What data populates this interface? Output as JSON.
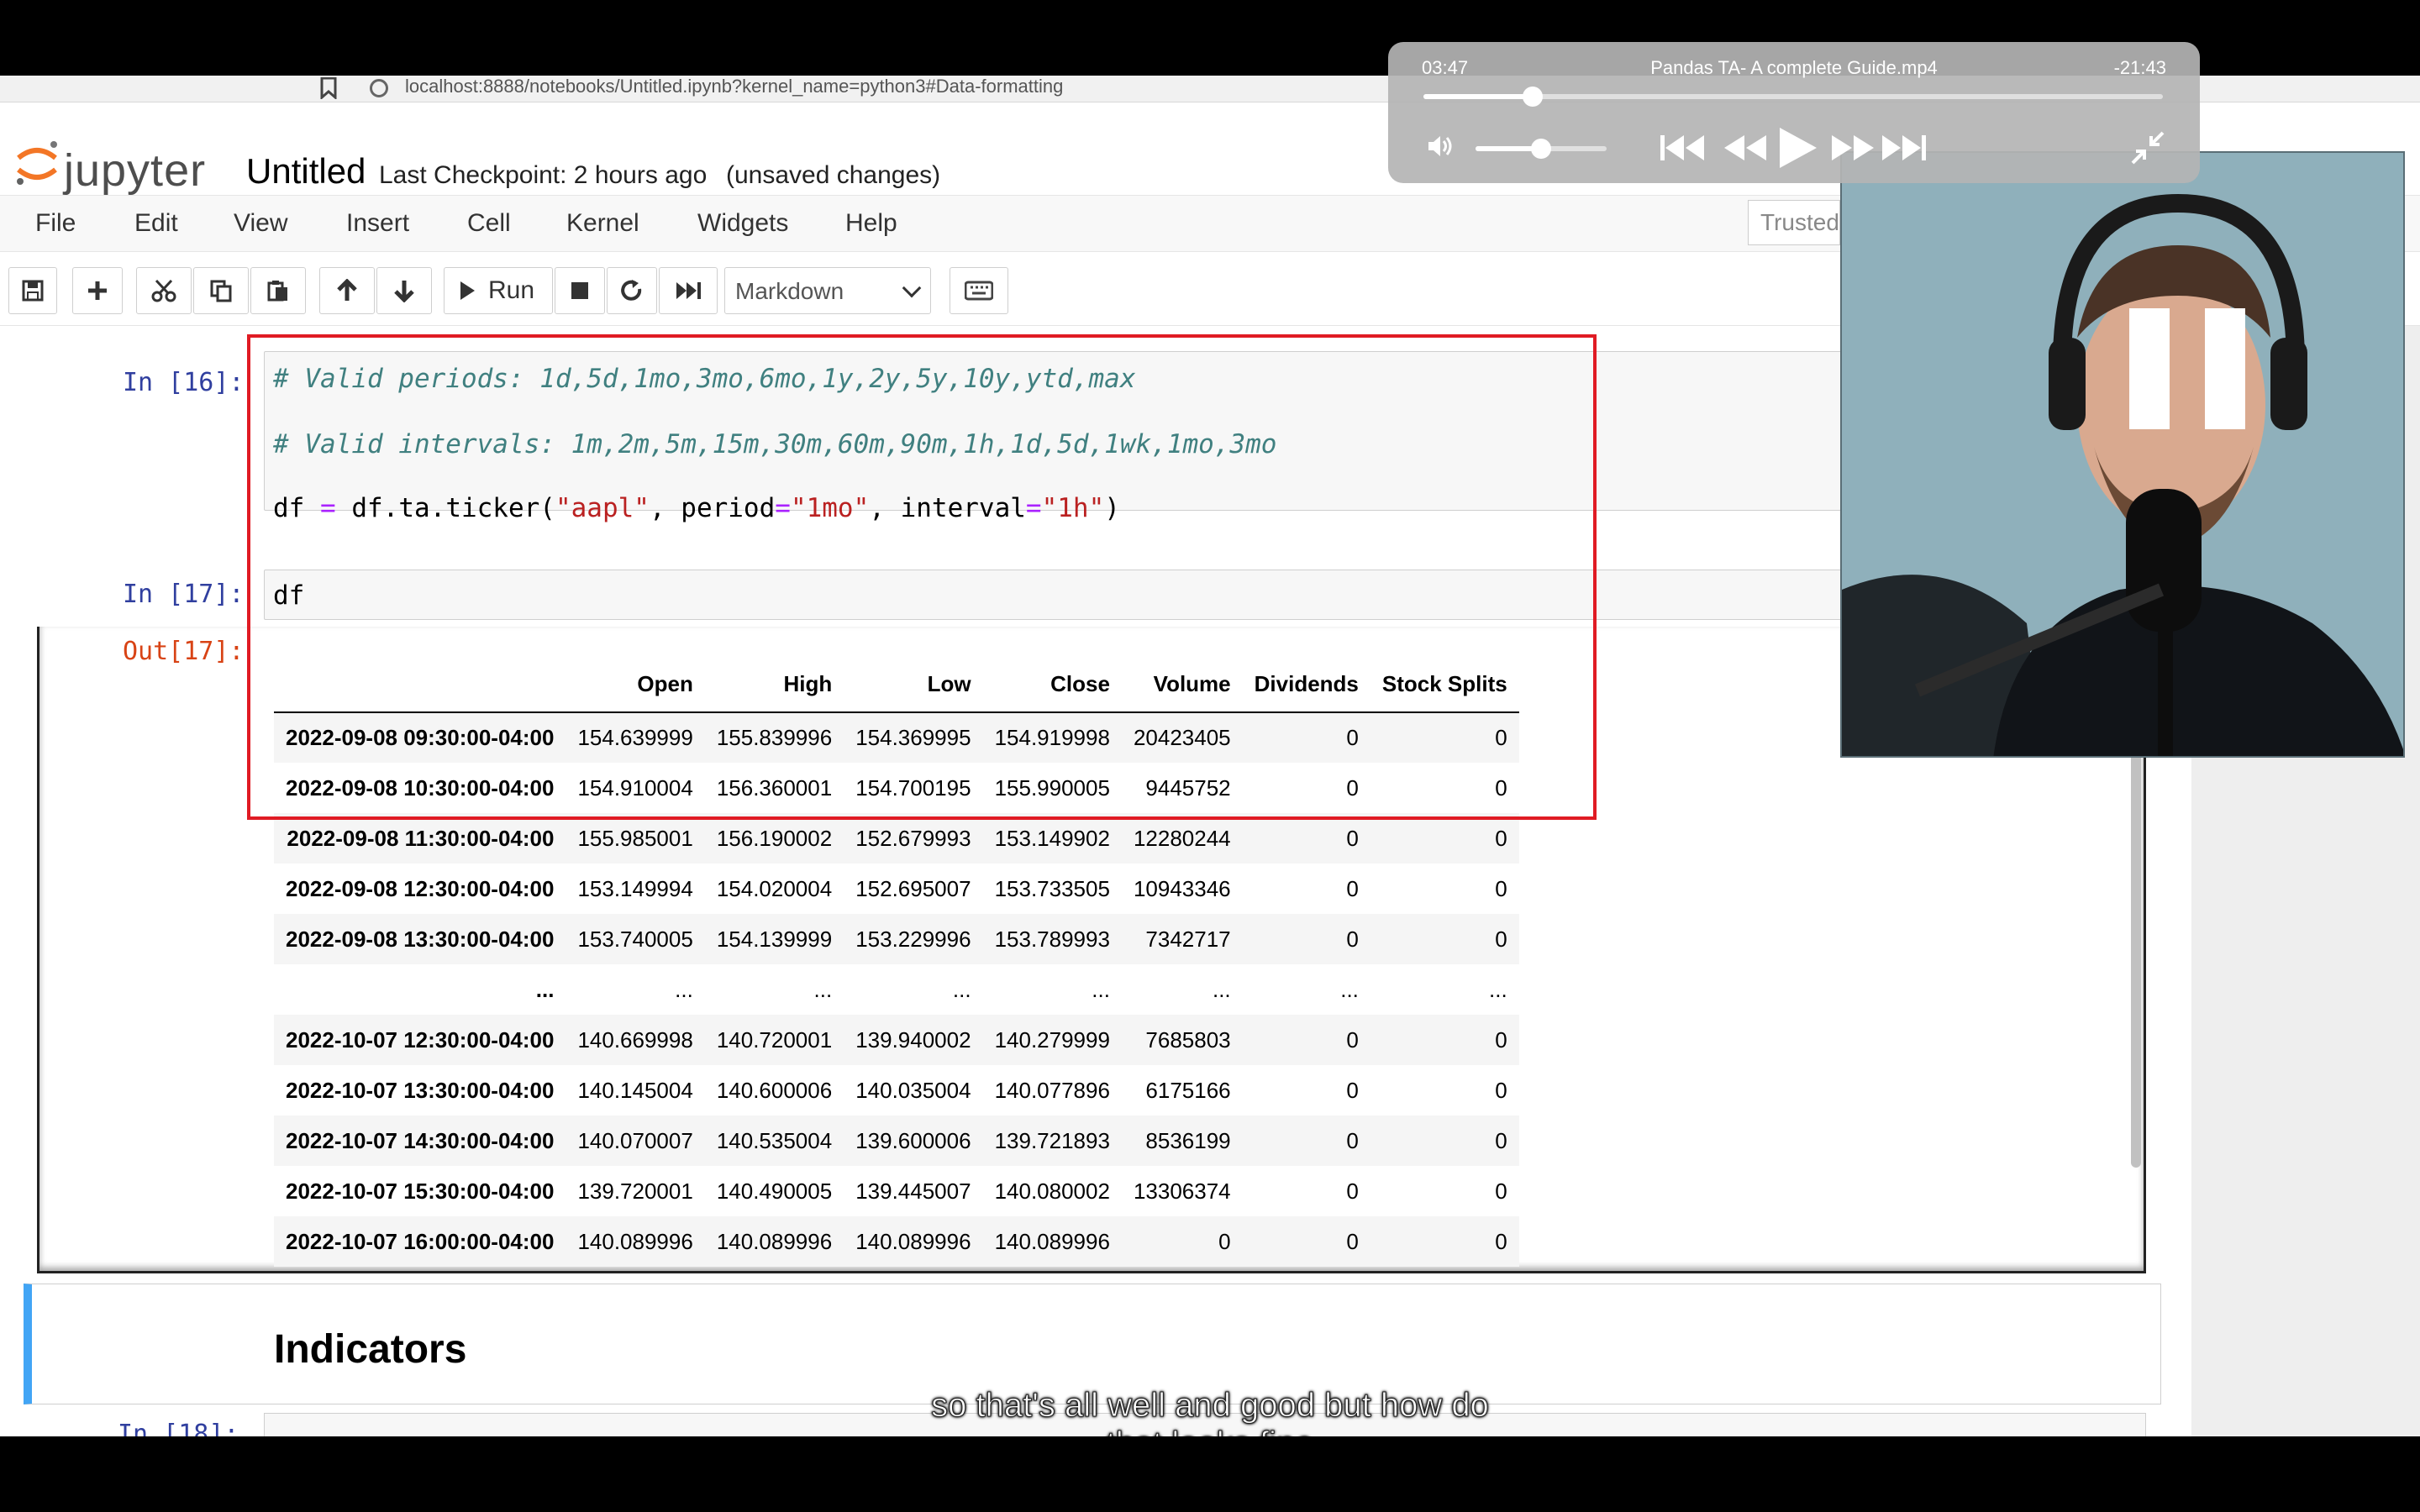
{
  "browser": {
    "url": "localhost:8888/notebooks/Untitled.ipynb?kernel_name=python3#Data-formatting"
  },
  "jupyter": {
    "logo_text": "jupyter",
    "notebook_name": "Untitled",
    "checkpoint": "Last Checkpoint: 2 hours ago",
    "unsaved": "(unsaved changes)",
    "trusted": "Trusted"
  },
  "menu": [
    "File",
    "Edit",
    "View",
    "Insert",
    "Cell",
    "Kernel",
    "Widgets",
    "Help"
  ],
  "toolbar": {
    "run_label": "Run",
    "cell_type": "Markdown"
  },
  "cells": {
    "in16_prompt": "In [16]:",
    "in16_line1": "# Valid periods: 1d,5d,1mo,3mo,6mo,1y,2y,5y,10y,ytd,max",
    "in16_line2": "# Valid intervals: 1m,2m,5m,15m,30m,60m,90m,1h,1d,5d,1wk,1mo,3mo",
    "in16_line3": {
      "a": "df ",
      "eq1": "=",
      "b": " df.ta.ticker(",
      "s1": "\"aapl\"",
      "c": ", period",
      "eq2": "=",
      "s2": "\"1mo\"",
      "d": ", interval",
      "eq3": "=",
      "s3": "\"1h\"",
      "e": ")"
    },
    "in17_prompt": "In [17]:",
    "in17_code": "df",
    "out17_prompt": "Out[17]:",
    "next_prompt": "In [18]:"
  },
  "dataframe": {
    "columns": [
      "",
      "Open",
      "High",
      "Low",
      "Close",
      "Volume",
      "Dividends",
      "Stock Splits"
    ],
    "rows": [
      [
        "2022-09-08 09:30:00-04:00",
        "154.639999",
        "155.839996",
        "154.369995",
        "154.919998",
        "20423405",
        "0",
        "0"
      ],
      [
        "2022-09-08 10:30:00-04:00",
        "154.910004",
        "156.360001",
        "154.700195",
        "155.990005",
        "9445752",
        "0",
        "0"
      ],
      [
        "2022-09-08 11:30:00-04:00",
        "155.985001",
        "156.190002",
        "152.679993",
        "153.149902",
        "12280244",
        "0",
        "0"
      ],
      [
        "2022-09-08 12:30:00-04:00",
        "153.149994",
        "154.020004",
        "152.695007",
        "153.733505",
        "10943346",
        "0",
        "0"
      ],
      [
        "2022-09-08 13:30:00-04:00",
        "153.740005",
        "154.139999",
        "153.229996",
        "153.789993",
        "7342717",
        "0",
        "0"
      ],
      [
        "...",
        "...",
        "...",
        "...",
        "...",
        "...",
        "...",
        "..."
      ],
      [
        "2022-10-07 12:30:00-04:00",
        "140.669998",
        "140.720001",
        "139.940002",
        "140.279999",
        "7685803",
        "0",
        "0"
      ],
      [
        "2022-10-07 13:30:00-04:00",
        "140.145004",
        "140.600006",
        "140.035004",
        "140.077896",
        "6175166",
        "0",
        "0"
      ],
      [
        "2022-10-07 14:30:00-04:00",
        "140.070007",
        "140.535004",
        "139.600006",
        "139.721893",
        "8536199",
        "0",
        "0"
      ],
      [
        "2022-10-07 15:30:00-04:00",
        "139.720001",
        "140.490005",
        "139.445007",
        "140.080002",
        "13306374",
        "0",
        "0"
      ],
      [
        "2022-10-07 16:00:00-04:00",
        "140.089996",
        "140.089996",
        "140.089996",
        "140.089996",
        "0",
        "0",
        "0"
      ]
    ]
  },
  "markdown": {
    "heading": "Indicators"
  },
  "player": {
    "elapsed": "03:47",
    "title": "Pandas TA- A complete Guide.mp4",
    "remaining": "-21:43",
    "progress": 0.148,
    "volume": 0.5
  },
  "subtitle": {
    "line1": "so that's all well and good but how do",
    "line2": "that looks fine"
  },
  "colors": {
    "highlight": "#e01b24",
    "markdown_bar": "#42a5f5",
    "prompt_in": "#303f9f",
    "prompt_out": "#d84315"
  }
}
